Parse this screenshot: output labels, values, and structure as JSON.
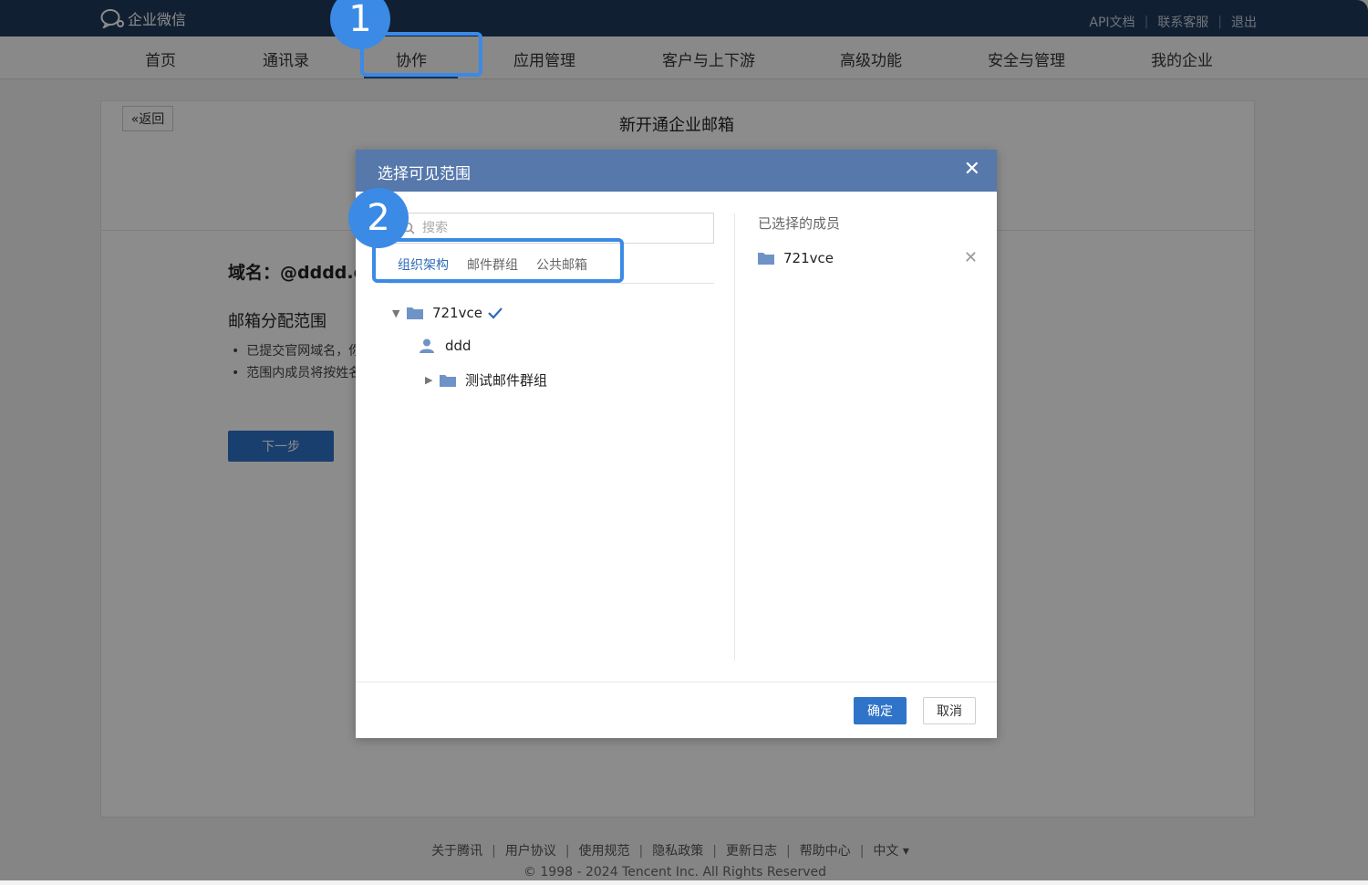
{
  "app": {
    "logo_text": "企业微信"
  },
  "top_links": [
    "API文档",
    "联系客服",
    "退出"
  ],
  "nav": {
    "items": [
      "首页",
      "通讯录",
      "协作",
      "应用管理",
      "客户与上下游",
      "高级功能",
      "安全与管理",
      "我的企业"
    ],
    "active": "协作"
  },
  "page": {
    "back_label": "«返回",
    "title": "新开通企业邮箱",
    "domain_label": "域名：@dddd.c",
    "section_title": "邮箱分配范围",
    "bullets": [
      "已提交官网域名，你",
      "范围内成员将按姓名"
    ],
    "next_label": "下一步"
  },
  "modal": {
    "title": "选择可见范围",
    "search_placeholder": "搜索",
    "tabs": [
      "组织架构",
      "邮件群组",
      "公共邮箱"
    ],
    "active_tab": "组织架构",
    "tree": {
      "root": "721vce",
      "user": "ddd",
      "group": "测试邮件群组"
    },
    "selected_title": "已选择的成员",
    "selected_items": [
      "721vce"
    ],
    "ok_label": "确定",
    "cancel_label": "取消"
  },
  "footer": {
    "links": [
      "关于腾讯",
      "用户协议",
      "使用规范",
      "隐私政策",
      "更新日志",
      "帮助中心",
      "中文 ▾"
    ],
    "copyright": "© 1998 - 2024 Tencent Inc. All Rights Reserved"
  },
  "annotations": {
    "step1": "1",
    "step2": "2"
  },
  "colors": {
    "topbar": "#1f3a5c",
    "modal_header": "#5678ab",
    "primary_button": "#2f74c8",
    "annotation": "#3b8ae6",
    "active_tab": "#2f6bb7"
  }
}
